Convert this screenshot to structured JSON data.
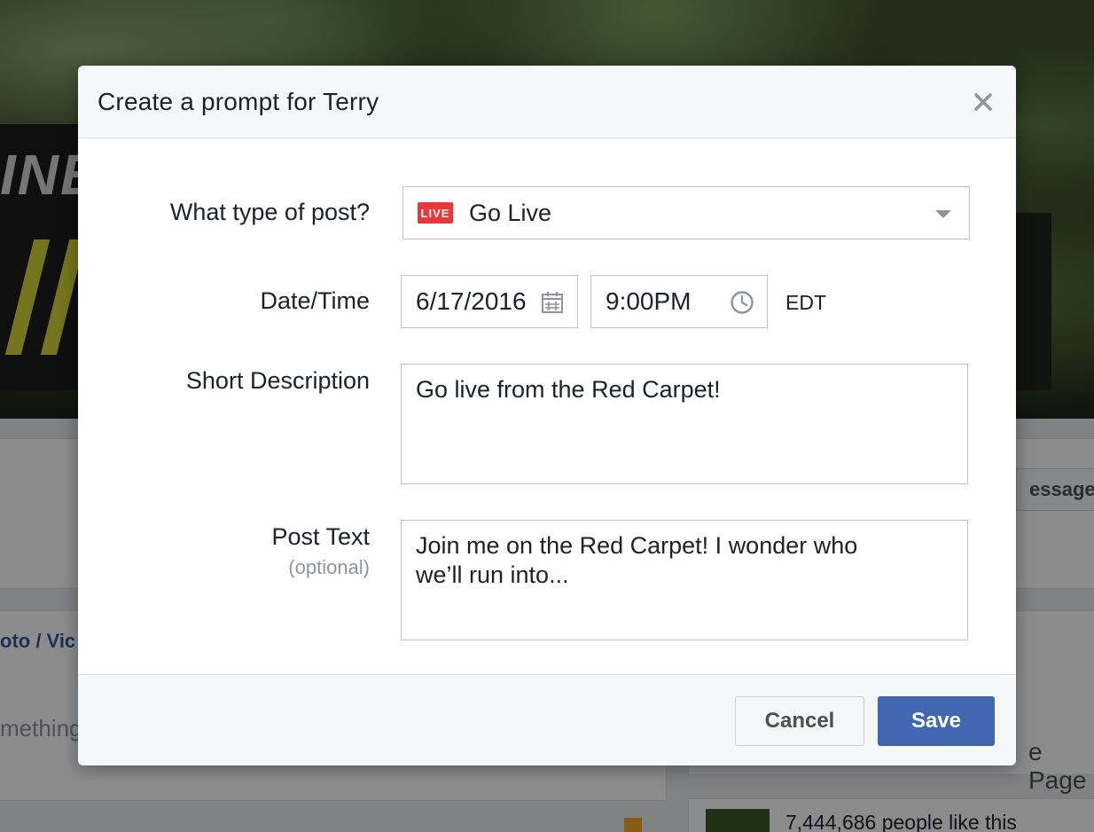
{
  "background": {
    "banner_text": "INE",
    "photo_video_tab": "oto / Vic",
    "composer_placeholder": "mething",
    "message_button": "essage",
    "like_page_button": "e Page",
    "likes_count": "7,444,686 people like this"
  },
  "dialog": {
    "title": "Create a prompt for Terry",
    "close_icon": "close-icon",
    "post_type": {
      "label": "What type of post?",
      "badge": "LIVE",
      "value": "Go Live"
    },
    "date_time": {
      "label": "Date/Time",
      "date": "6/17/2016",
      "time": "9:00PM",
      "timezone": "EDT"
    },
    "short_description": {
      "label": "Short Description",
      "value": "Go live from the Red Carpet!"
    },
    "post_text": {
      "label": "Post Text",
      "sublabel": "(optional)",
      "value": "Join me on the Red Carpet! I wonder who\nwe’ll run into..."
    },
    "cancel_label": "Cancel",
    "save_label": "Save"
  },
  "colors": {
    "primary": "#4267b2",
    "live_badge": "#e9373c",
    "link": "#365899"
  }
}
